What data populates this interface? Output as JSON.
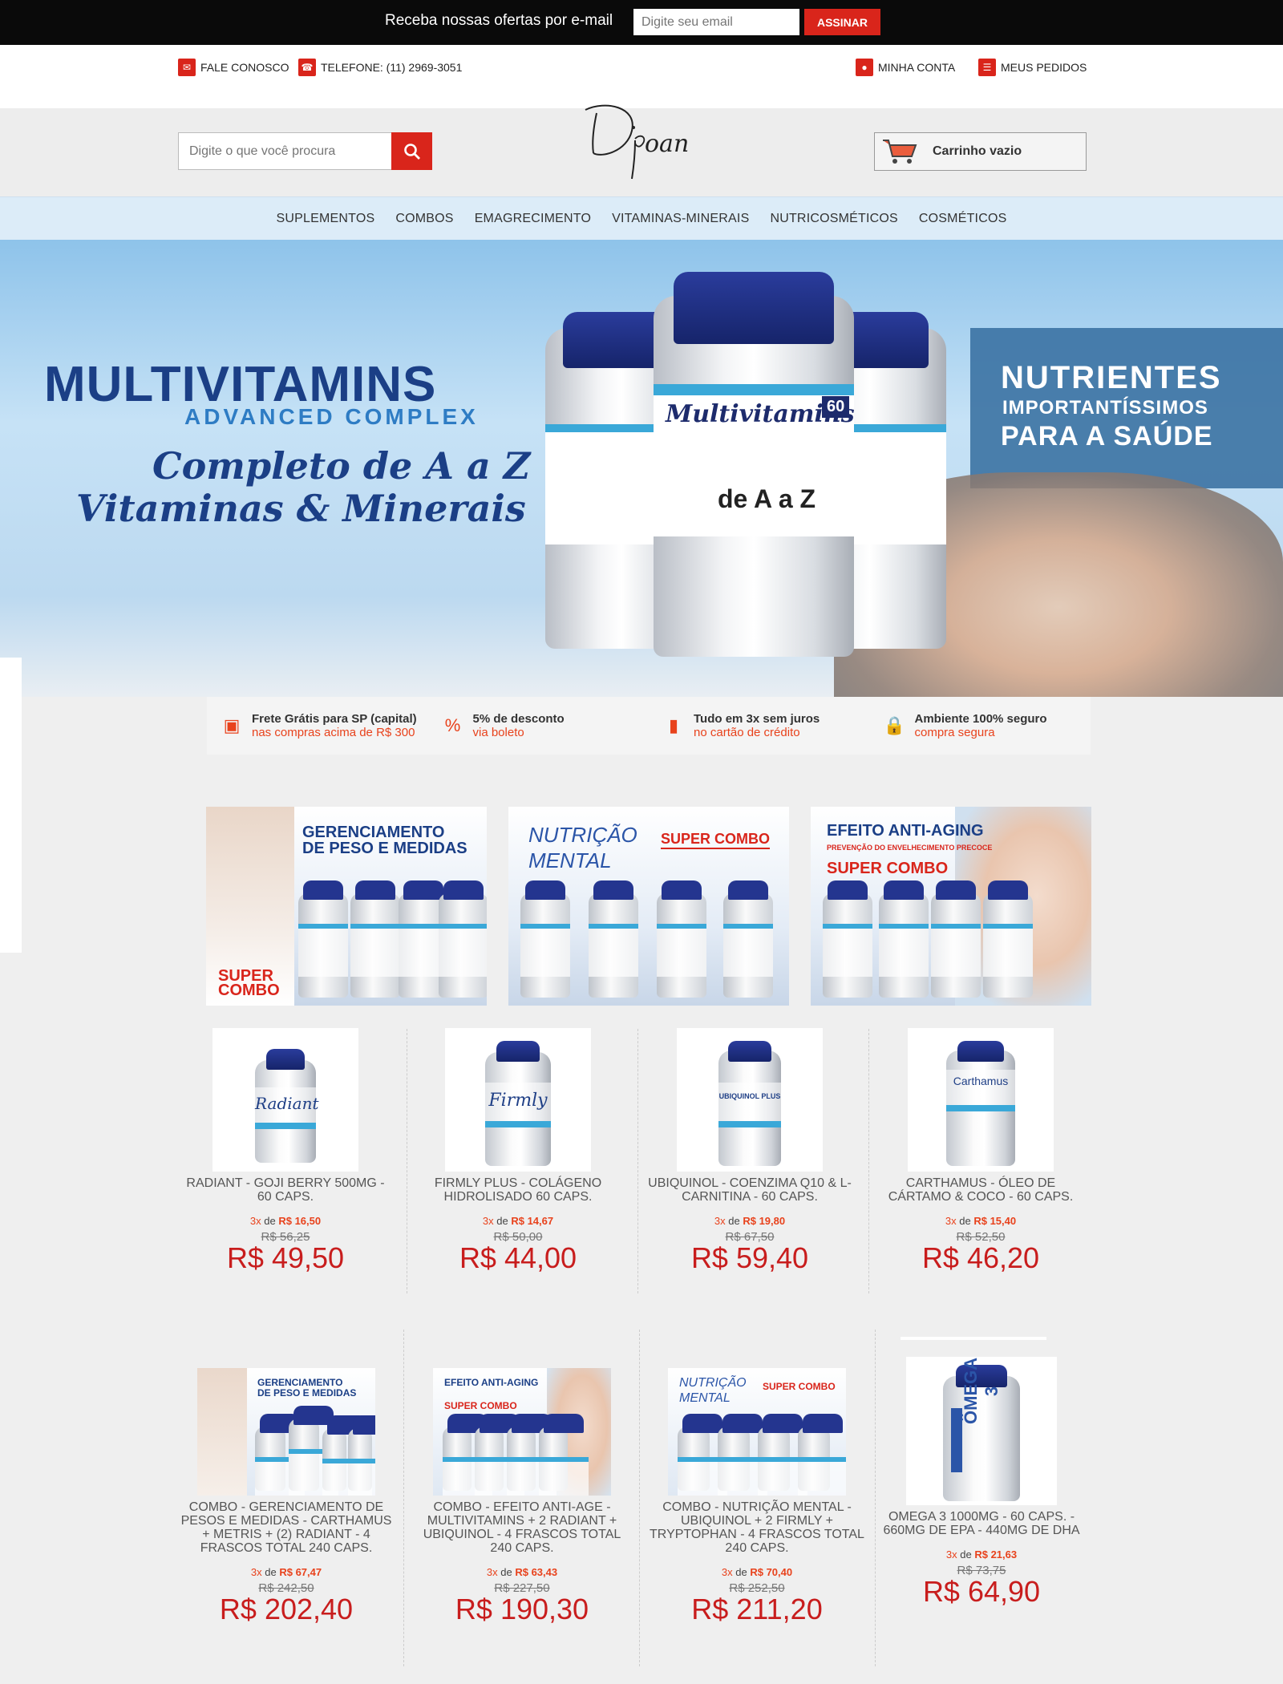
{
  "newsletter": {
    "label": "Receba nossas ofertas por e-mail",
    "placeholder": "Digite seu email",
    "button": "ASSINAR"
  },
  "utility": {
    "contact": "FALE CONOSCO",
    "phone": "TELEFONE: (11) 2969-3051",
    "account": "MINHA CONTA",
    "orders": "MEUS PEDIDOS"
  },
  "header": {
    "search_placeholder": "Digite o que você procura",
    "logo_text": "Dpoan",
    "cart_label": "Carrinho vazio"
  },
  "nav": {
    "items": [
      "SUPLEMENTOS",
      "COMBOS",
      "EMAGRECIMENTO",
      "VITAMINAS-MINERAIS",
      "NUTRICOSMÉTICOS",
      "COSMÉTICOS"
    ]
  },
  "banner": {
    "title": "MULTIVITAMINS",
    "subtitle": "ADVANCED COMPLEX",
    "script1": "Completo de A a Z",
    "script2": "Vitaminas & Minerais",
    "right1": "NUTRIENTES",
    "right2": "IMPORTANTÍSSIMOS",
    "right3": "PARA A SAÚDE",
    "bottle_name": "Multivitamins",
    "bottle_az": "de A a Z",
    "bottle_count": "60"
  },
  "benefits": [
    {
      "t1": "Frete Grátis para SP (capital)",
      "t2": "nas compras acima de R$ 300",
      "icon": "box-icon"
    },
    {
      "t1": "5% de desconto",
      "t2": "via boleto",
      "icon": "percent-icon"
    },
    {
      "t1": "Tudo em 3x sem juros",
      "t2": "no cartão de crédito",
      "icon": "card-icon"
    },
    {
      "t1": "Ambiente 100% seguro",
      "t2": "compra segura",
      "icon": "lock-icon"
    }
  ],
  "combos": [
    {
      "line1": "GERENCIAMENTO",
      "line2": "DE PESO E MEDIDAS",
      "badge1": "SUPER",
      "badge2": "COMBO"
    },
    {
      "line1": "NUTRIÇÃO",
      "line2": "MENTAL",
      "badge1": "SUPER COMBO"
    },
    {
      "line1": "EFEITO ANTI-AGING",
      "line2": "PREVENÇÃO DO ENVELHECIMENTO PRECOCE",
      "badge1": "SUPER COMBO"
    }
  ],
  "products_row1": [
    {
      "name": "RADIANT - GOJI BERRY 500MG - 60 CAPS.",
      "inst_n": "3x",
      "inst_de": "de",
      "inst_val": "R$ 16,50",
      "old": "R$ 56,25",
      "price": "R$ 49,50",
      "brand": "Radiant"
    },
    {
      "name": "FIRMLY PLUS - COLÁGENO HIDROLISADO 60 CAPS.",
      "inst_n": "3x",
      "inst_de": "de",
      "inst_val": "R$ 14,67",
      "old": "R$ 50,00",
      "price": "R$ 44,00",
      "brand": "Firmly"
    },
    {
      "name": "UBIQUINOL - COENZIMA Q10 & L-CARNITINA - 60 CAPS.",
      "inst_n": "3x",
      "inst_de": "de",
      "inst_val": "R$ 19,80",
      "old": "R$ 67,50",
      "price": "R$ 59,40",
      "brand": "UBIQUINOL PLUS"
    },
    {
      "name": "CARTHAMUS - ÓLEO DE CÁRTAMO & COCO - 60 CAPS.",
      "inst_n": "3x",
      "inst_de": "de",
      "inst_val": "R$ 15,40",
      "old": "R$ 52,50",
      "price": "R$ 46,20",
      "brand": "Carthamus"
    }
  ],
  "products_row2": [
    {
      "name": "COMBO - GERENCIAMENTO DE PESOS E MEDIDAS - CARTHAMUS + METRIS + (2) RADIANT - 4 FRASCOS TOTAL 240 CAPS.",
      "inst_n": "3x",
      "inst_de": "de",
      "inst_val": "R$ 67,47",
      "old": "R$ 242,50",
      "price": "R$ 202,40"
    },
    {
      "name": "COMBO - EFEITO ANTI-AGE - MULTIVITAMINS + 2 RADIANT + UBIQUINOL - 4 FRASCOS TOTAL 240 CAPS.",
      "inst_n": "3x",
      "inst_de": "de",
      "inst_val": "R$ 63,43",
      "old": "R$ 227,50",
      "price": "R$ 190,30"
    },
    {
      "name": "COMBO - NUTRIÇÃO MENTAL - UBIQUINOL + 2 FIRMLY + TRYPTOPHAN - 4 FRASCOS TOTAL 240 CAPS.",
      "inst_n": "3x",
      "inst_de": "de",
      "inst_val": "R$ 70,40",
      "old": "R$ 252,50",
      "price": "R$ 211,20"
    },
    {
      "name": "OMEGA 3 1000MG - 60 CAPS. - 660MG DE EPA - 440MG DE DHA",
      "inst_n": "3x",
      "inst_de": "de",
      "inst_val": "R$ 21,63",
      "old": "R$ 73,75",
      "price": "R$ 64,90",
      "brand": "ÔMEGA 3"
    }
  ],
  "colors": {
    "accent": "#d9251b",
    "brand_blue": "#1b3f86",
    "price_red": "#c81d1d"
  }
}
